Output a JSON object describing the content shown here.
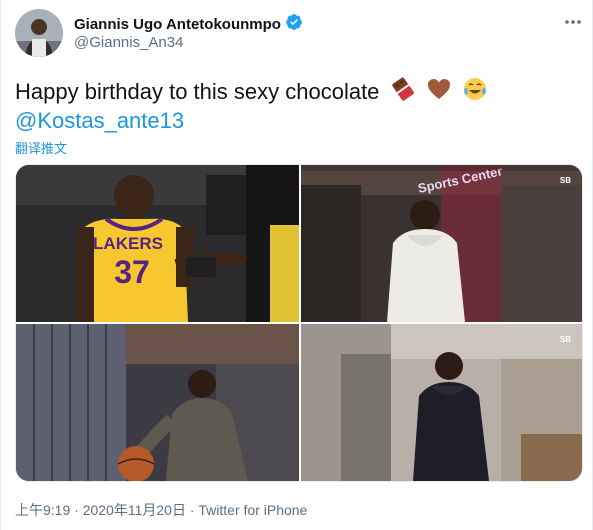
{
  "user": {
    "display_name": "Giannis Ugo Antetokounmpo",
    "handle": "@Giannis_An34",
    "verified_icon": "verified-badge-icon",
    "avatar_icon": "avatar"
  },
  "tweet": {
    "text": "Happy birthday to this sexy chocolate",
    "emojis": [
      "chocolate-bar-emoji",
      "brown-heart-emoji",
      "tears-of-joy-emoji"
    ],
    "mention": "@Kostas_ante13",
    "translate_label": "翻译推文"
  },
  "media": {
    "photos": [
      {
        "name": "photo-lakers-37",
        "jersey_text": "LAKERS",
        "jersey_number": "37"
      },
      {
        "name": "photo-white-hoodie",
        "sign_text": "Sports Center"
      },
      {
        "name": "photo-lockers-basketball"
      },
      {
        "name": "photo-black-hoodie"
      }
    ],
    "corner_logo": "SB"
  },
  "footer": {
    "time": "上午9:19",
    "date": "2020年11月20日",
    "source": "Twitter for iPhone",
    "separator": "·"
  },
  "colors": {
    "link": "#1b95e0",
    "secondary_text": "#5b7083",
    "verified": "#1da1f2"
  }
}
